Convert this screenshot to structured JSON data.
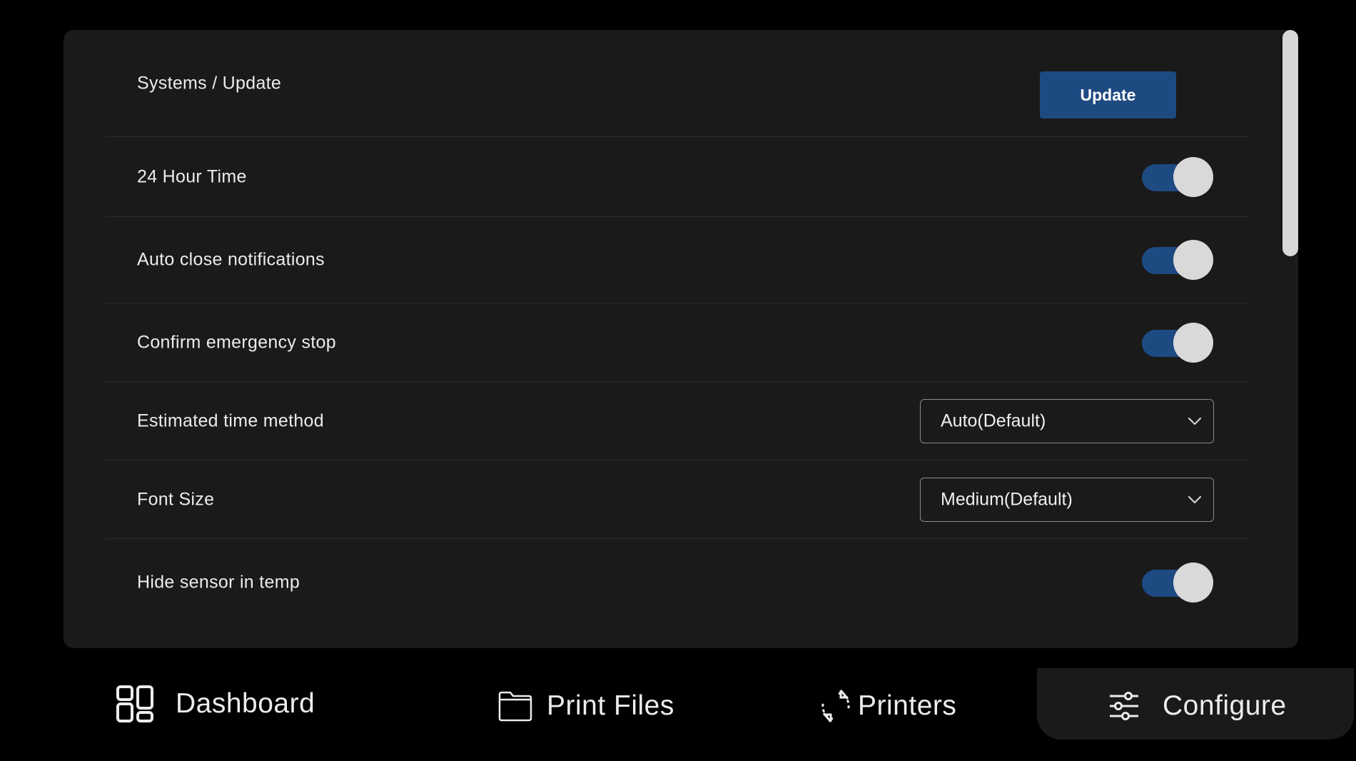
{
  "settings": {
    "rows": [
      {
        "label": "Systems / Update",
        "control": "button",
        "button_label": "Update"
      },
      {
        "label": "24 Hour Time",
        "control": "toggle",
        "on": true
      },
      {
        "label": "Auto close notifications",
        "control": "toggle",
        "on": true
      },
      {
        "label": "Confirm emergency stop",
        "control": "toggle",
        "on": true
      },
      {
        "label": "Estimated time method",
        "control": "select",
        "value": "Auto(Default)"
      },
      {
        "label": "Font Size",
        "control": "select",
        "value": "Medium(Default)"
      },
      {
        "label": "Hide sensor in temp",
        "control": "toggle",
        "on": true
      }
    ]
  },
  "nav": {
    "dashboard": {
      "label": "Dashboard",
      "icon": "dashboard-grid-icon"
    },
    "print_files": {
      "label": "Print Files",
      "icon": "folder-icon"
    },
    "printers": {
      "label": "Printers",
      "icon": "sync-arrows-icon"
    },
    "configure": {
      "label": "Configure",
      "icon": "sliders-icon",
      "active": true
    }
  },
  "colors": {
    "accent": "#1e4a82",
    "panel": "#1a1a1a",
    "background": "#000000",
    "knob": "#d9d9d9"
  }
}
